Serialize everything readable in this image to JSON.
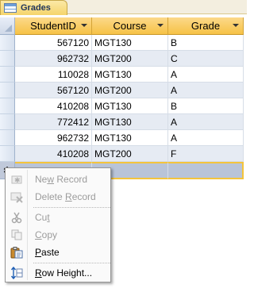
{
  "tab": {
    "label": "Grades"
  },
  "columns": [
    "StudentID",
    "Course",
    "Grade"
  ],
  "rows": [
    {
      "student_id": "567120",
      "course": "MGT130",
      "grade": "B"
    },
    {
      "student_id": "962732",
      "course": "MGT200",
      "grade": "C"
    },
    {
      "student_id": "110028",
      "course": "MGT130",
      "grade": "A"
    },
    {
      "student_id": "567120",
      "course": "MGT200",
      "grade": "A"
    },
    {
      "student_id": "410208",
      "course": "MGT130",
      "grade": "B"
    },
    {
      "student_id": "772412",
      "course": "MGT130",
      "grade": "A"
    },
    {
      "student_id": "962732",
      "course": "MGT130",
      "grade": "A"
    },
    {
      "student_id": "410208",
      "course": "MGT200",
      "grade": "F"
    }
  ],
  "new_record_marker": "✱",
  "context_menu": {
    "new_record": {
      "label": "New Record",
      "underline": "w",
      "enabled": false
    },
    "delete_record": {
      "label": "Delete Record",
      "underline": "R",
      "enabled": false
    },
    "cut": {
      "label": "Cut",
      "underline": "t",
      "enabled": false
    },
    "copy": {
      "label": "Copy",
      "underline": "C",
      "enabled": false
    },
    "paste": {
      "label": "Paste",
      "underline": "P",
      "enabled": true
    },
    "row_height": {
      "label": "Row Height...",
      "underline": "R",
      "enabled": true
    }
  },
  "colors": {
    "header": "#f6c246",
    "alt_row": "#e6ebf3",
    "new_row": "#b9c4d8",
    "focus_border": "#f4c43c"
  }
}
